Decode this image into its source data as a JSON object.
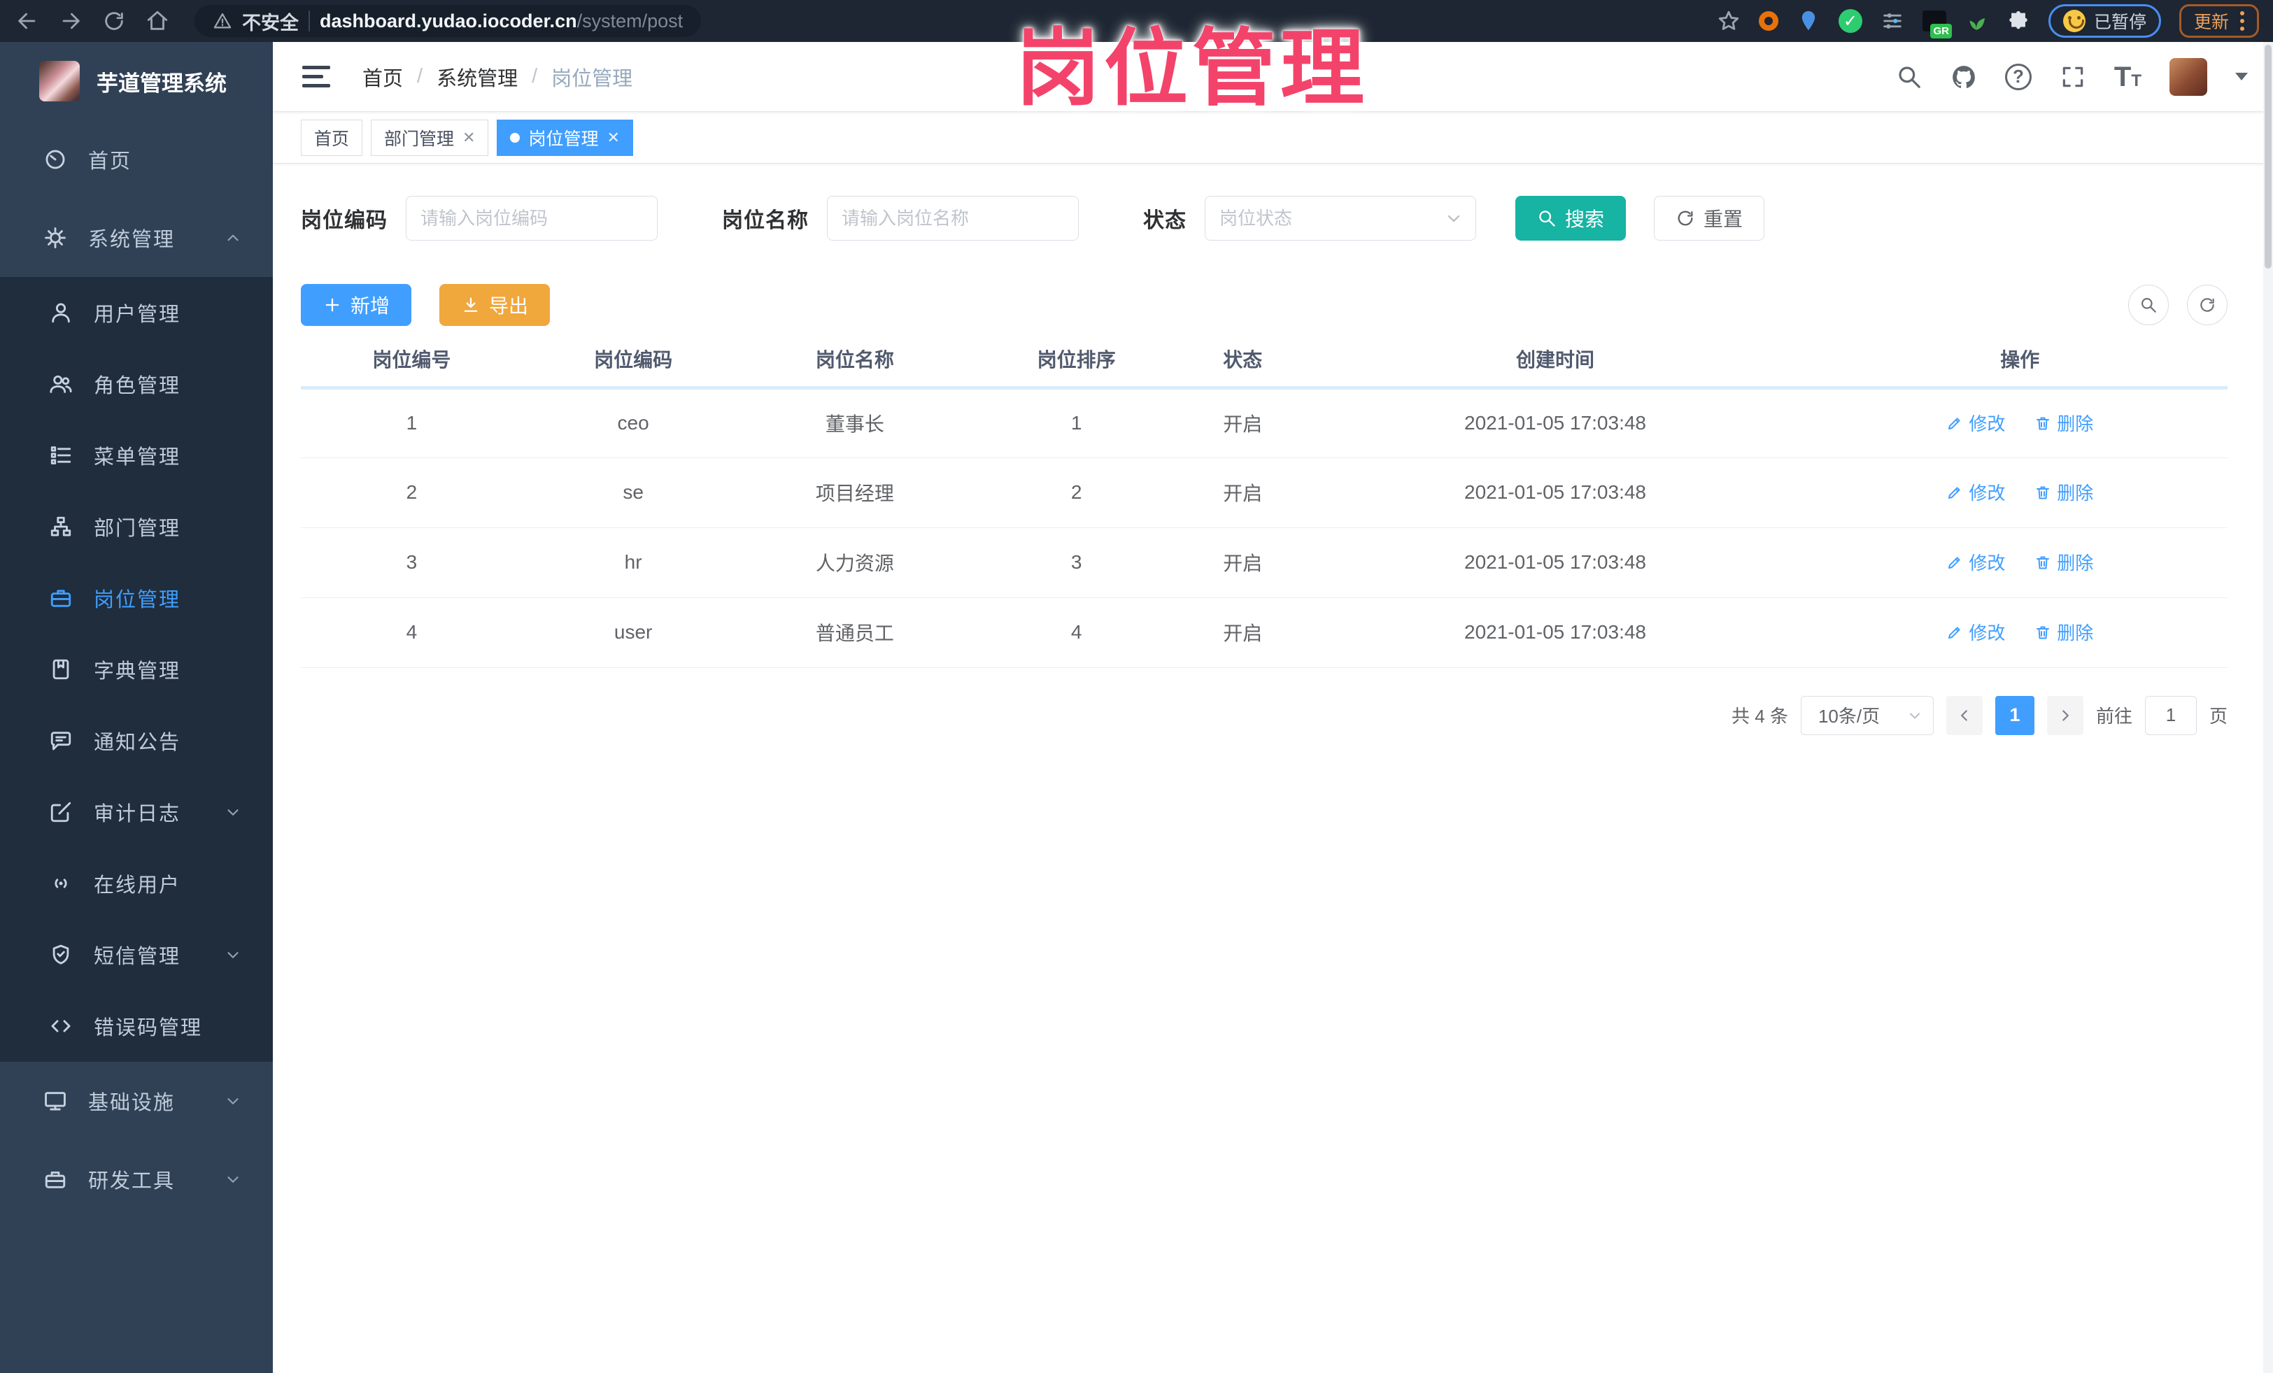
{
  "colors": {
    "accent_blue": "#409eff",
    "search_teal": "#17b3a3",
    "export_orange": "#f0a73c",
    "overlay_pink": "#f4436a",
    "sidebar_bg": "#304156",
    "submenu_bg": "#1f2d3d"
  },
  "overlay_title": "岗位管理",
  "browser": {
    "security_label": "不安全",
    "url_host": "dashboard.yudao.iocoder.cn",
    "url_path": "/system/post",
    "nav_icons": [
      "back-icon",
      "forward-icon",
      "reload-icon",
      "home-icon"
    ],
    "extension_icons": [
      "bookmark-star-icon",
      "orange-ring-icon",
      "blue-pin-icon",
      "green-check-icon",
      "sliders-icon",
      "gr-badge-icon",
      "plant-icon",
      "puzzle-icon"
    ],
    "paused_label": "已暂停",
    "update_label": "更新"
  },
  "sidebar": {
    "app_title": "芋道管理系统",
    "items": [
      {
        "label": "首页",
        "icon": "gauge-icon"
      },
      {
        "label": "系统管理",
        "icon": "gear-icon",
        "expanded": true
      },
      {
        "label": "用户管理",
        "icon": "user-icon"
      },
      {
        "label": "角色管理",
        "icon": "users-icon"
      },
      {
        "label": "菜单管理",
        "icon": "menu-list-icon"
      },
      {
        "label": "部门管理",
        "icon": "org-tree-icon"
      },
      {
        "label": "岗位管理",
        "icon": "briefcase-icon",
        "active": true
      },
      {
        "label": "字典管理",
        "icon": "book-icon"
      },
      {
        "label": "通知公告",
        "icon": "notice-bubble-icon"
      },
      {
        "label": "审计日志",
        "icon": "edit-square-icon",
        "collapsible": true
      },
      {
        "label": "在线用户",
        "icon": "signal-icon"
      },
      {
        "label": "短信管理",
        "icon": "shield-icon",
        "collapsible": true
      },
      {
        "label": "错误码管理",
        "icon": "code-icon"
      },
      {
        "label": "基础设施",
        "icon": "monitor-icon",
        "collapsible": true
      },
      {
        "label": "研发工具",
        "icon": "toolbox-icon",
        "collapsible": true
      }
    ]
  },
  "header": {
    "breadcrumb": [
      "首页",
      "系统管理",
      "岗位管理"
    ],
    "right_icons": [
      "search-icon",
      "github-icon",
      "help-icon",
      "fullscreen-icon",
      "font-size-icon",
      "avatar",
      "caret-down-icon"
    ]
  },
  "tags": [
    {
      "label": "首页"
    },
    {
      "label": "部门管理",
      "closable": true
    },
    {
      "label": "岗位管理",
      "closable": true,
      "active": true
    }
  ],
  "filters": {
    "code_label": "岗位编码",
    "code_placeholder": "请输入岗位编码",
    "name_label": "岗位名称",
    "name_placeholder": "请输入岗位名称",
    "status_label": "状态",
    "status_placeholder": "岗位状态",
    "search_label": "搜索",
    "reset_label": "重置"
  },
  "toolbar": {
    "add_label": "新增",
    "export_label": "导出"
  },
  "table": {
    "headers": [
      "岗位编号",
      "岗位编码",
      "岗位名称",
      "岗位排序",
      "状态",
      "创建时间",
      "操作"
    ],
    "edit_label": "修改",
    "delete_label": "删除",
    "rows": [
      {
        "id": "1",
        "code": "ceo",
        "name": "董事长",
        "sort": "1",
        "status": "开启",
        "created_at": "2021-01-05 17:03:48"
      },
      {
        "id": "2",
        "code": "se",
        "name": "项目经理",
        "sort": "2",
        "status": "开启",
        "created_at": "2021-01-05 17:03:48"
      },
      {
        "id": "3",
        "code": "hr",
        "name": "人力资源",
        "sort": "3",
        "status": "开启",
        "created_at": "2021-01-05 17:03:48"
      },
      {
        "id": "4",
        "code": "user",
        "name": "普通员工",
        "sort": "4",
        "status": "开启",
        "created_at": "2021-01-05 17:03:48"
      }
    ]
  },
  "pagination": {
    "total": "共 4 条",
    "page_size": "10条/页",
    "page": "1",
    "goto_label": "前往",
    "goto_value": "1",
    "unit_label": "页"
  }
}
